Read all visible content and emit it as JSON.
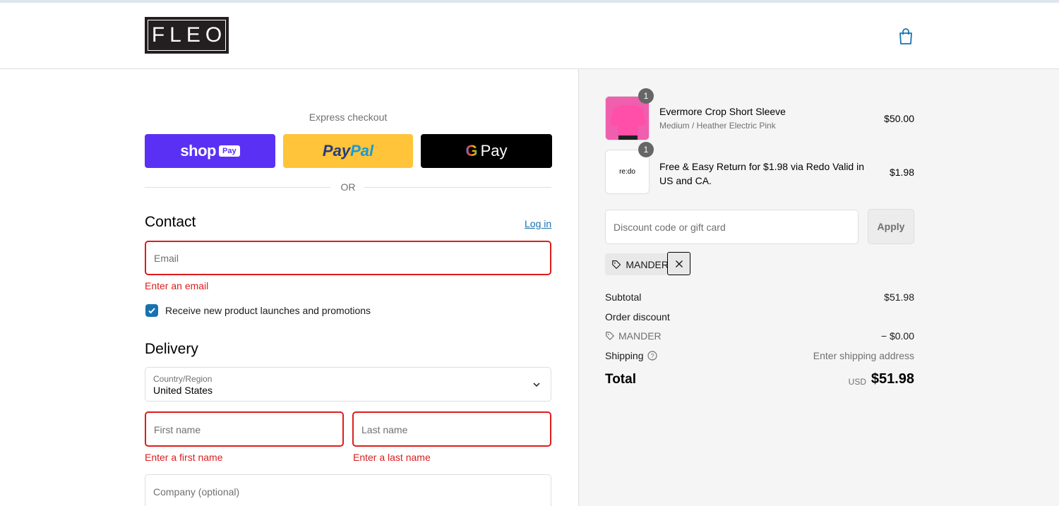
{
  "header": {
    "logo_text": "FLEO",
    "cart_icon": "shopping-bag-icon"
  },
  "express": {
    "label": "Express checkout",
    "shop_pay": {
      "word": "shop",
      "badge": "Pay"
    },
    "paypal": {
      "part1": "Pay",
      "part2": "Pal"
    },
    "gpay": {
      "letter": "G",
      "word": "Pay"
    },
    "or_label": "OR"
  },
  "contact": {
    "title": "Contact",
    "login_label": "Log in",
    "email_placeholder": "Email",
    "email_error": "Enter an email",
    "newsletter_label": "Receive new product launches and promotions",
    "newsletter_checked": true
  },
  "delivery": {
    "title": "Delivery",
    "country_label": "Country/Region",
    "country_value": "United States",
    "first_name_placeholder": "First name",
    "first_name_error": "Enter a first name",
    "last_name_placeholder": "Last name",
    "last_name_error": "Enter a last name",
    "company_placeholder": "Company (optional)"
  },
  "order": {
    "items": [
      {
        "title": "Evermore Crop Short Sleeve",
        "variant": "Medium / Heather Electric Pink",
        "price": "$50.00",
        "qty": "1"
      },
      {
        "title": "Free & Easy Return for $1.98 via Redo Valid in US and CA.",
        "variant": "",
        "price": "$1.98",
        "qty": "1",
        "logo_text": "re:do"
      }
    ],
    "discount_placeholder": "Discount code or gift card",
    "apply_label": "Apply",
    "applied_code": "MANDER",
    "subtotal_label": "Subtotal",
    "subtotal_value": "$51.98",
    "order_discount_label": "Order discount",
    "discount_code_label": "MANDER",
    "discount_value": "− $0.00",
    "shipping_label": "Shipping",
    "shipping_value": "Enter shipping address",
    "total_label": "Total",
    "total_currency": "USD",
    "total_value": "$51.98"
  },
  "colors": {
    "accent": "#1773b0",
    "error": "#dd1d1d",
    "shop_pay": "#5a31f4",
    "paypal": "#ffc439"
  }
}
